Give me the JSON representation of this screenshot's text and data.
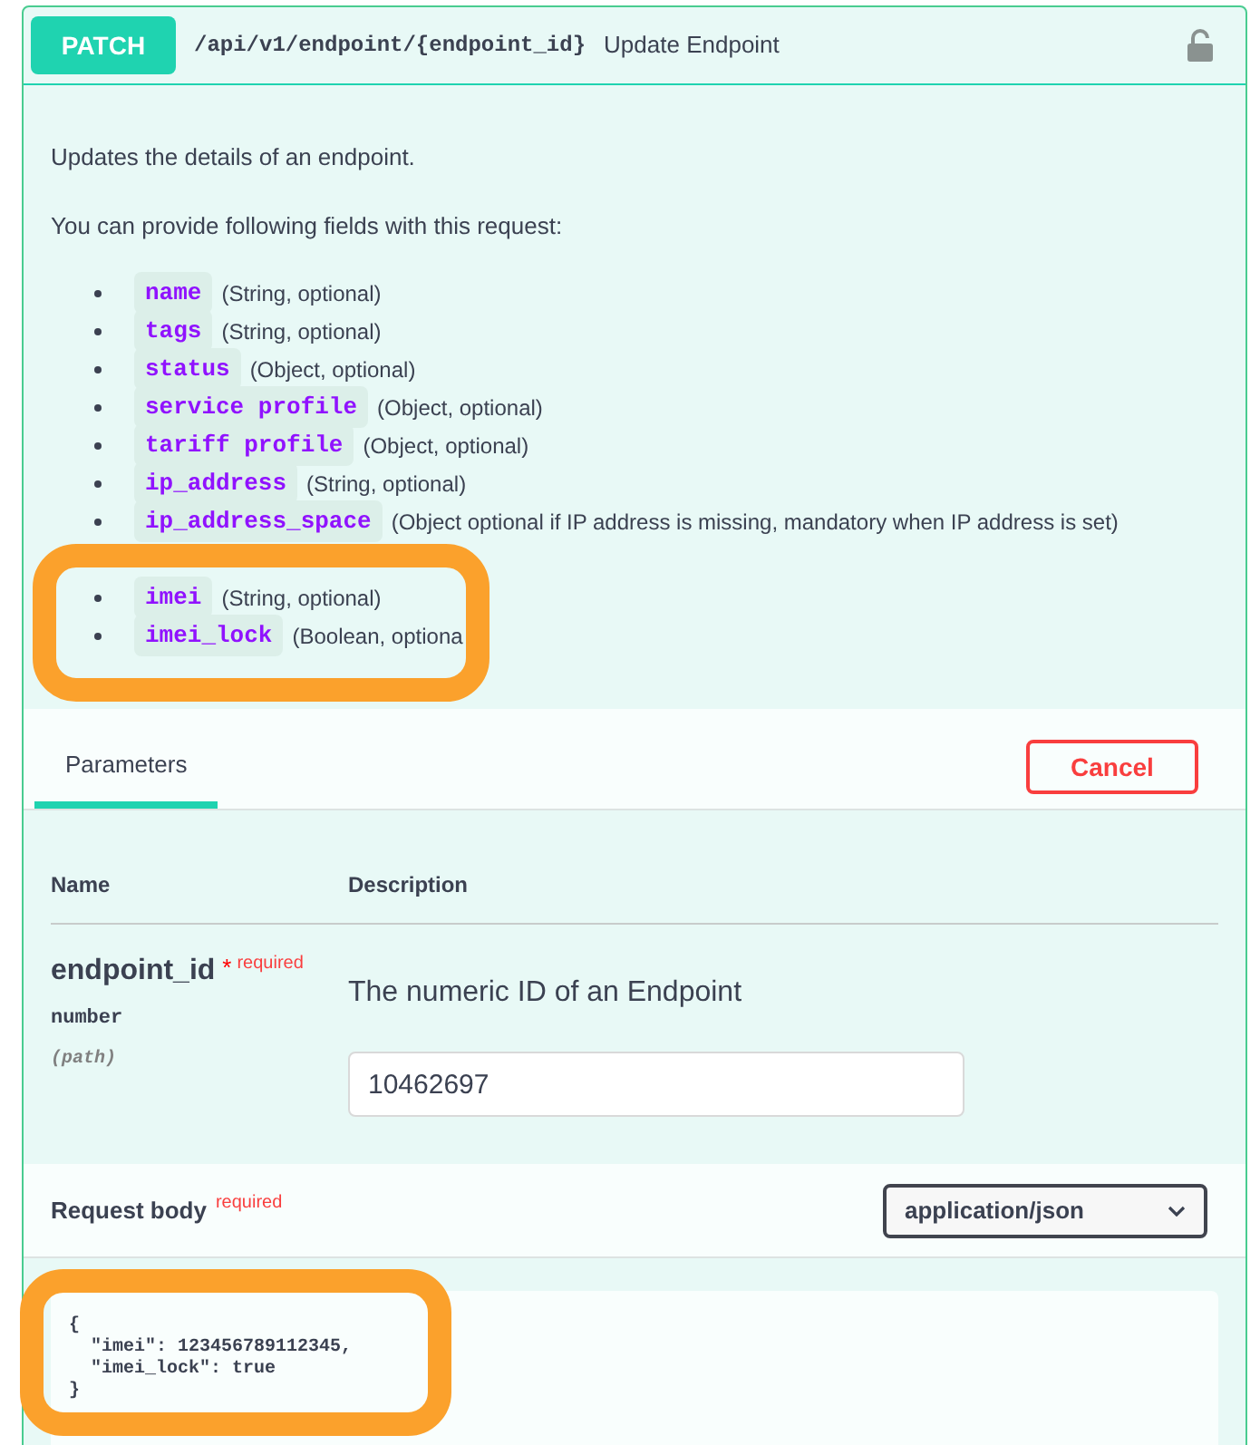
{
  "operation": {
    "method": "PATCH",
    "path": "/api/v1/endpoint/{endpoint_id}",
    "summary": "Update Endpoint"
  },
  "description": "Updates the details of an endpoint.",
  "fields_intro": "You can provide following fields with this request:",
  "fields": [
    {
      "name": "name",
      "type": "(String, optional)",
      "highlighted": false
    },
    {
      "name": "tags",
      "type": "(String, optional)",
      "highlighted": false
    },
    {
      "name": "status",
      "type": "(Object, optional)",
      "highlighted": false
    },
    {
      "name": "service profile",
      "type": "(Object, optional)",
      "highlighted": false
    },
    {
      "name": "tariff profile",
      "type": "(Object, optional)",
      "highlighted": false
    },
    {
      "name": "ip_address",
      "type": "(String, optional)",
      "highlighted": false
    },
    {
      "name": "ip_address_space",
      "type": "(Object optional if IP address is missing, mandatory when IP address is set)",
      "highlighted": false
    },
    {
      "name": "imei",
      "type": "(String, optional)",
      "highlighted": true
    },
    {
      "name": "imei_lock",
      "type": "(Boolean, optiona",
      "highlighted": true
    }
  ],
  "tabs": [
    {
      "label": "Parameters",
      "selected": true
    }
  ],
  "cancel_button": "Cancel",
  "parameters": {
    "columns": [
      "Name",
      "Description"
    ],
    "rows": [
      {
        "name": "endpoint_id",
        "required_mark": "*",
        "required_label": "required",
        "type": "number",
        "location": "(path)",
        "description": "The numeric ID of an Endpoint",
        "value": "10462697"
      }
    ]
  },
  "request_body": {
    "title": "Request body",
    "required_label": "required",
    "content_type": "application/json",
    "code_lines": [
      "{",
      "  \"imei\": 123456789112345,",
      "  \"imei_lock\": true",
      "}"
    ],
    "highlighted": true
  }
}
